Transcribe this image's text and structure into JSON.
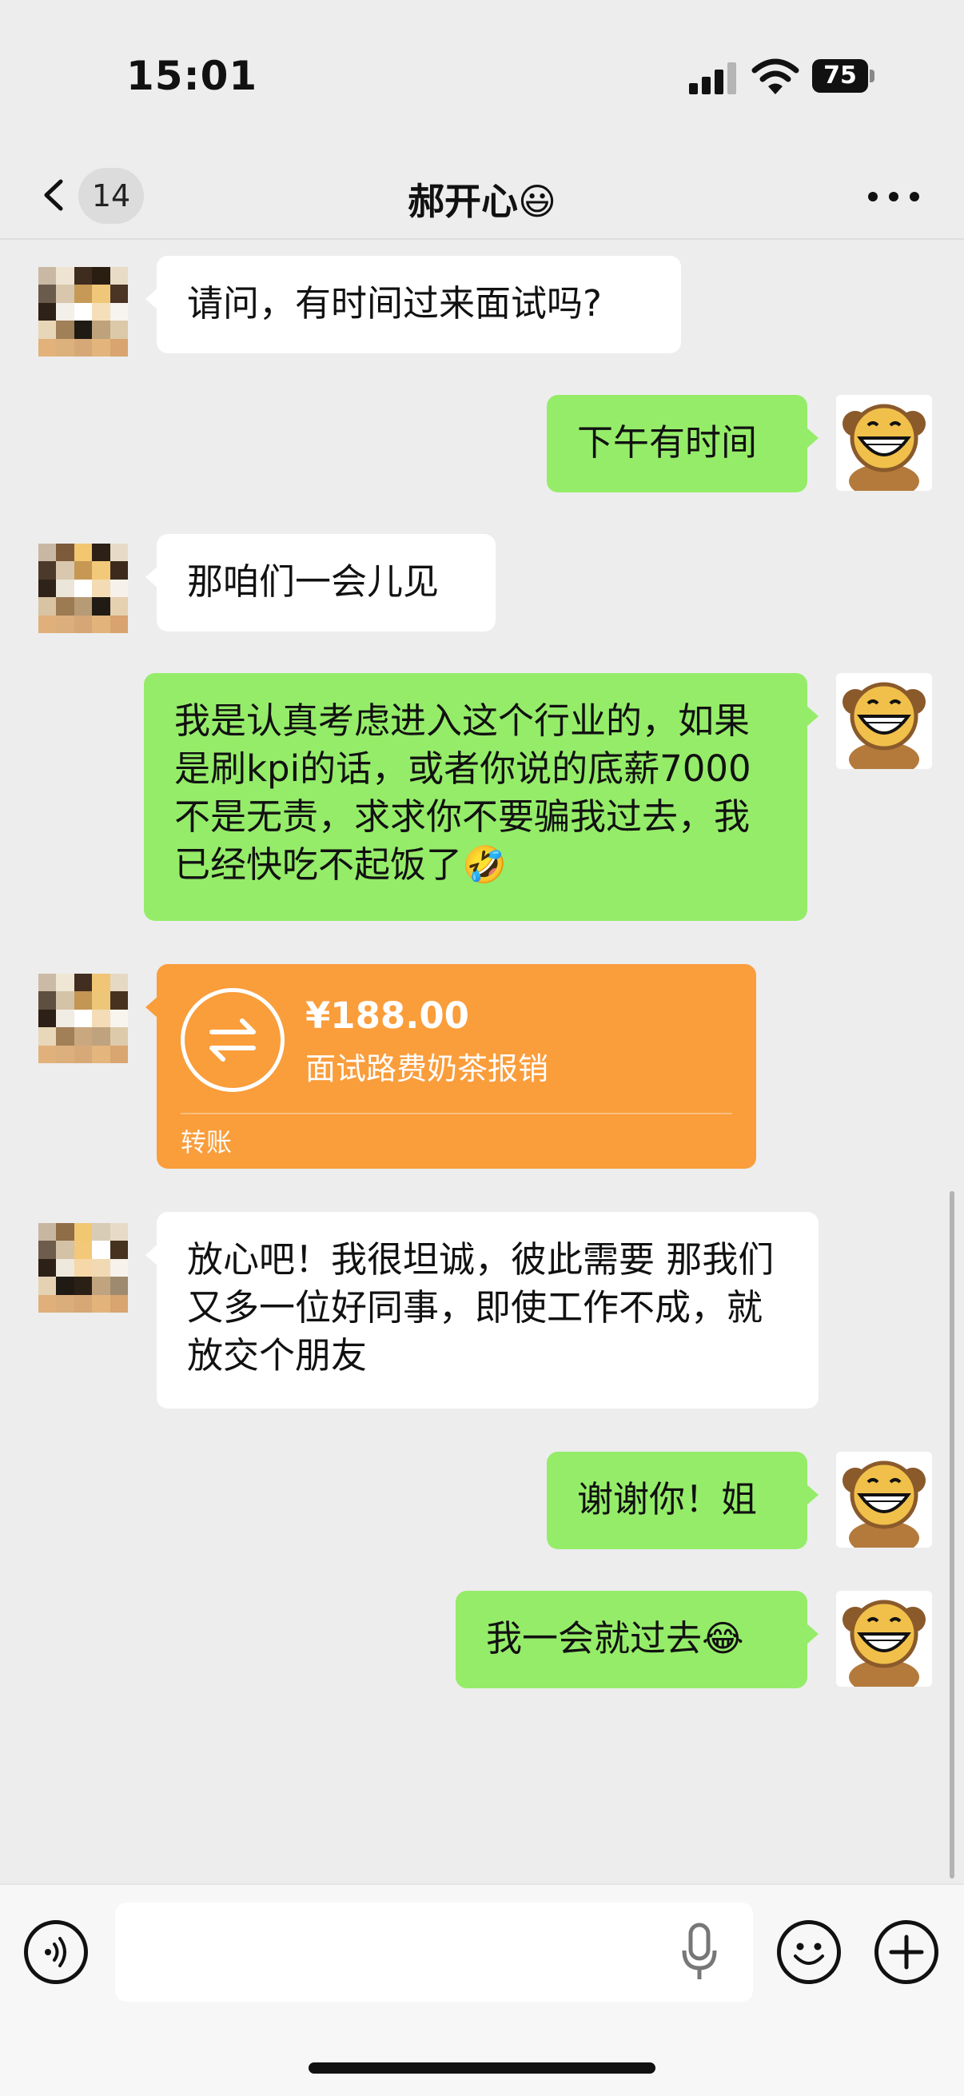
{
  "status_bar": {
    "time": "15:01",
    "battery": "75"
  },
  "nav": {
    "unread_count": "14",
    "title": "郝开心😃"
  },
  "messages": [
    {
      "side": "in",
      "text": "请问，有时间过来面试吗?"
    },
    {
      "side": "out",
      "text": "下午有时间"
    },
    {
      "side": "in",
      "text": "那咱们一会儿见"
    },
    {
      "side": "out",
      "text": "我是认真考虑进入这个行业的，如果是刷kpi的话，或者你说的底薪7000不是无责，求求你不要骗我过去，我已经快吃不起饭了🤣"
    },
    {
      "side": "in",
      "type": "transfer"
    },
    {
      "side": "in",
      "text": "放心吧！我很坦诚，彼此需要 那我们又多一位好同事，即使工作不成，就放交个朋友"
    },
    {
      "side": "out",
      "text": "谢谢你！姐"
    },
    {
      "side": "out",
      "text": "我一会就过去😂"
    }
  ],
  "transfer": {
    "amount": "¥188.00",
    "note": "面试路费奶茶报销",
    "label": "转账"
  },
  "colors": {
    "background": "#ededed",
    "outgoing_bubble": "#95ec69",
    "incoming_bubble": "#ffffff",
    "transfer_card": "#fa9d3b"
  },
  "icons": {
    "back": "chevron-left-icon",
    "more": "more-dots-icon",
    "voice": "voice-icon",
    "mic": "microphone-icon",
    "emoji": "emoji-icon",
    "add": "plus-icon",
    "transfer": "transfer-arrows-icon"
  }
}
